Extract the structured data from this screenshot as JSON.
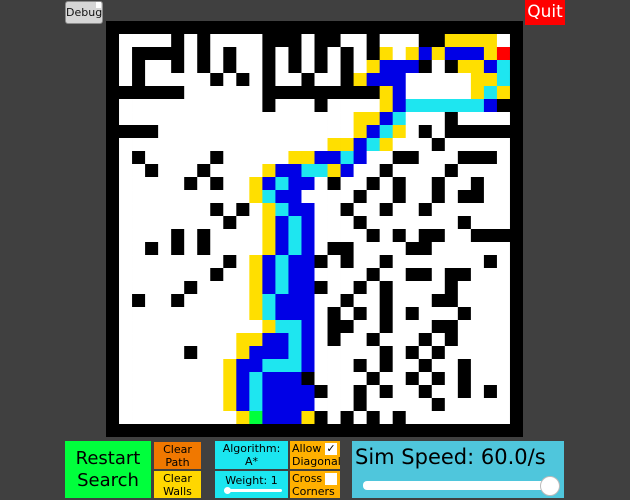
{
  "buttons": {
    "debug": "Debug",
    "quit": "Quit",
    "restart_line1": "Restart",
    "restart_line2": "Search",
    "clear_path_line1": "Clear",
    "clear_path_line2": "Path",
    "clear_walls_line1": "Clear",
    "clear_walls_line2": "Walls"
  },
  "algorithm": {
    "label": "Algorithm:",
    "value": "A*"
  },
  "weight": {
    "label": "Weight: 1",
    "value": 1,
    "slider_fraction": 0.05
  },
  "allow_diagonal": {
    "line1": "Allow",
    "line2": "Diagonal",
    "checked": true,
    "check_glyph": "✓"
  },
  "cross_corners": {
    "line1": "Cross",
    "line2": "Corners",
    "checked": false
  },
  "sim_speed": {
    "label": "Sim Speed: 60.0/s",
    "value": 60.0,
    "slider_fraction": 1.0
  },
  "colors": {
    "background": "#404040",
    "wall": "#000000",
    "empty": "#ffffff",
    "closed": "#0000e6",
    "open": "#ffdf00",
    "path": "#1ee6f0",
    "target": "#ff0000",
    "start": "#00ff3c"
  },
  "grid": {
    "cols": 32,
    "rows": 32,
    "cells": [
      "################################",
      "#....#.#....###.##..#...##OOOO.#",
      "#.####.#.#..#.#.#.#.#O.OCOCCCOT#",
      "#.#..#.#.#..#.#.#.#.OCCC#.#OOCP#",
      "#.#.....#.#.#..#..#OCCC.....OOP#",
      "######......#########OC.....OPO#",
      "#...........#...#....OCPPPPPPC##",
      "#..................OOCP...#....#",
      "####...............OCPO.#.######",
      "#................OOCPO...#.....#",
      "#.#.....#.....OOCCPC..##...###.#",
      "#..#...#....OCCPPOC..#....#....#",
      "#.....#.#..OCPCC.#..#.#..#..#..#",
      "#..........OPCC....#..#..#.##..#",
      "#.......#.#.OPCC..#..#..#......#",
      "#........#..OCPC...#.......#...#",
      "#....#.#....OCPC....#.#.##..####",
      "#..#.#.#....OCPC.##....##......#",
      "#........#.OCPCC#.#..#.......#.#",
      "#.......#..OCPCC....#..##.##...#",
      "#.....#....OCPCC#..#.#....#....#",
      "#.#..#.....OPCCC..#..#...##....#",
      "#..........OPCCC.#.#.#.#...#...#",
      "#...........OPPC.##..#...##....#",
      "#.........OOCCPC.#..#...#.#....#",
      "#.....#...OCCCPC.....#.#.#.....#",
      "#........OCCPPPC...#.#..#..#...#",
      "#........OCPCCC#....#..#.#.#...#",
      "#........OCPCCCC#..#.#..#..#.#.#",
      "#........OCPCCCC...#.....#.....#",
      "#.........OSCCCO#.#.#.#........#",
      "################################"
    ]
  }
}
